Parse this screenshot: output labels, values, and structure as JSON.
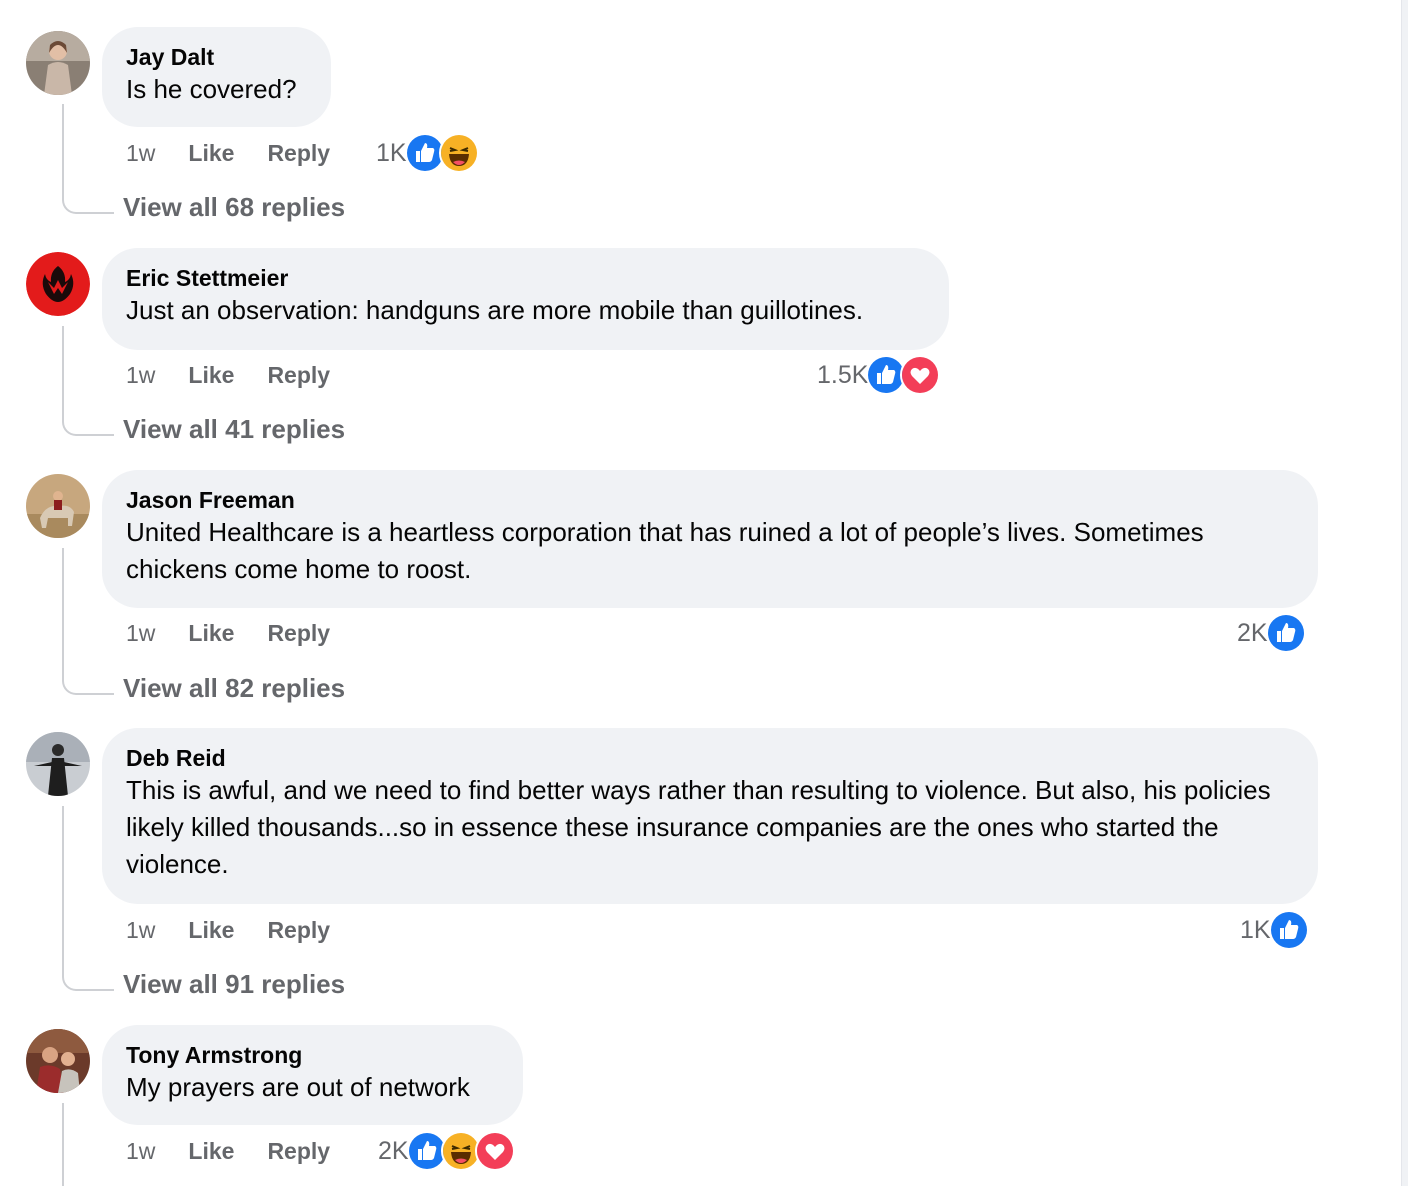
{
  "comments": [
    {
      "author": "Jay Dalt",
      "text": "Is he covered?",
      "time": "1w",
      "like": "Like",
      "reply": "Reply",
      "reaction_count": "1K",
      "reactions": [
        "like-icon",
        "haha-icon"
      ],
      "view_replies": "View all 68 replies"
    },
    {
      "author": "Eric Stettmeier",
      "text": "Just an observation: handguns are more mobile than guillotines.",
      "time": "1w",
      "like": "Like",
      "reply": "Reply",
      "reaction_count": "1.5K",
      "reactions": [
        "like-icon",
        "love-icon"
      ],
      "view_replies": "View all 41 replies"
    },
    {
      "author": "Jason Freeman",
      "text": "United Healthcare is a heartless corporation that has ruined a lot of people’s lives. Sometimes chickens come home to roost.",
      "time": "1w",
      "like": "Like",
      "reply": "Reply",
      "reaction_count": "2K",
      "reactions": [
        "like-icon"
      ],
      "view_replies": "View all 82 replies"
    },
    {
      "author": "Deb Reid",
      "text": "This is awful, and we need to find better ways rather than resulting to violence. But also, his policies likely killed thousands...so in essence these insurance companies are the ones who started the violence.",
      "time": "1w",
      "like": "Like",
      "reply": "Reply",
      "reaction_count": "1K",
      "reactions": [
        "like-icon"
      ],
      "view_replies": "View all 91 replies"
    },
    {
      "author": "Tony Armstrong",
      "text": "My prayers are out of network",
      "time": "1w",
      "like": "Like",
      "reply": "Reply",
      "reaction_count": "2K",
      "reactions": [
        "like-icon",
        "haha-icon",
        "love-icon"
      ]
    }
  ],
  "colors": {
    "bubble": "#f0f2f5",
    "like_blue": "#1877f2",
    "love_red": "#f33e58",
    "haha_yellow": "#f7b125",
    "muted_text": "#65676b"
  }
}
